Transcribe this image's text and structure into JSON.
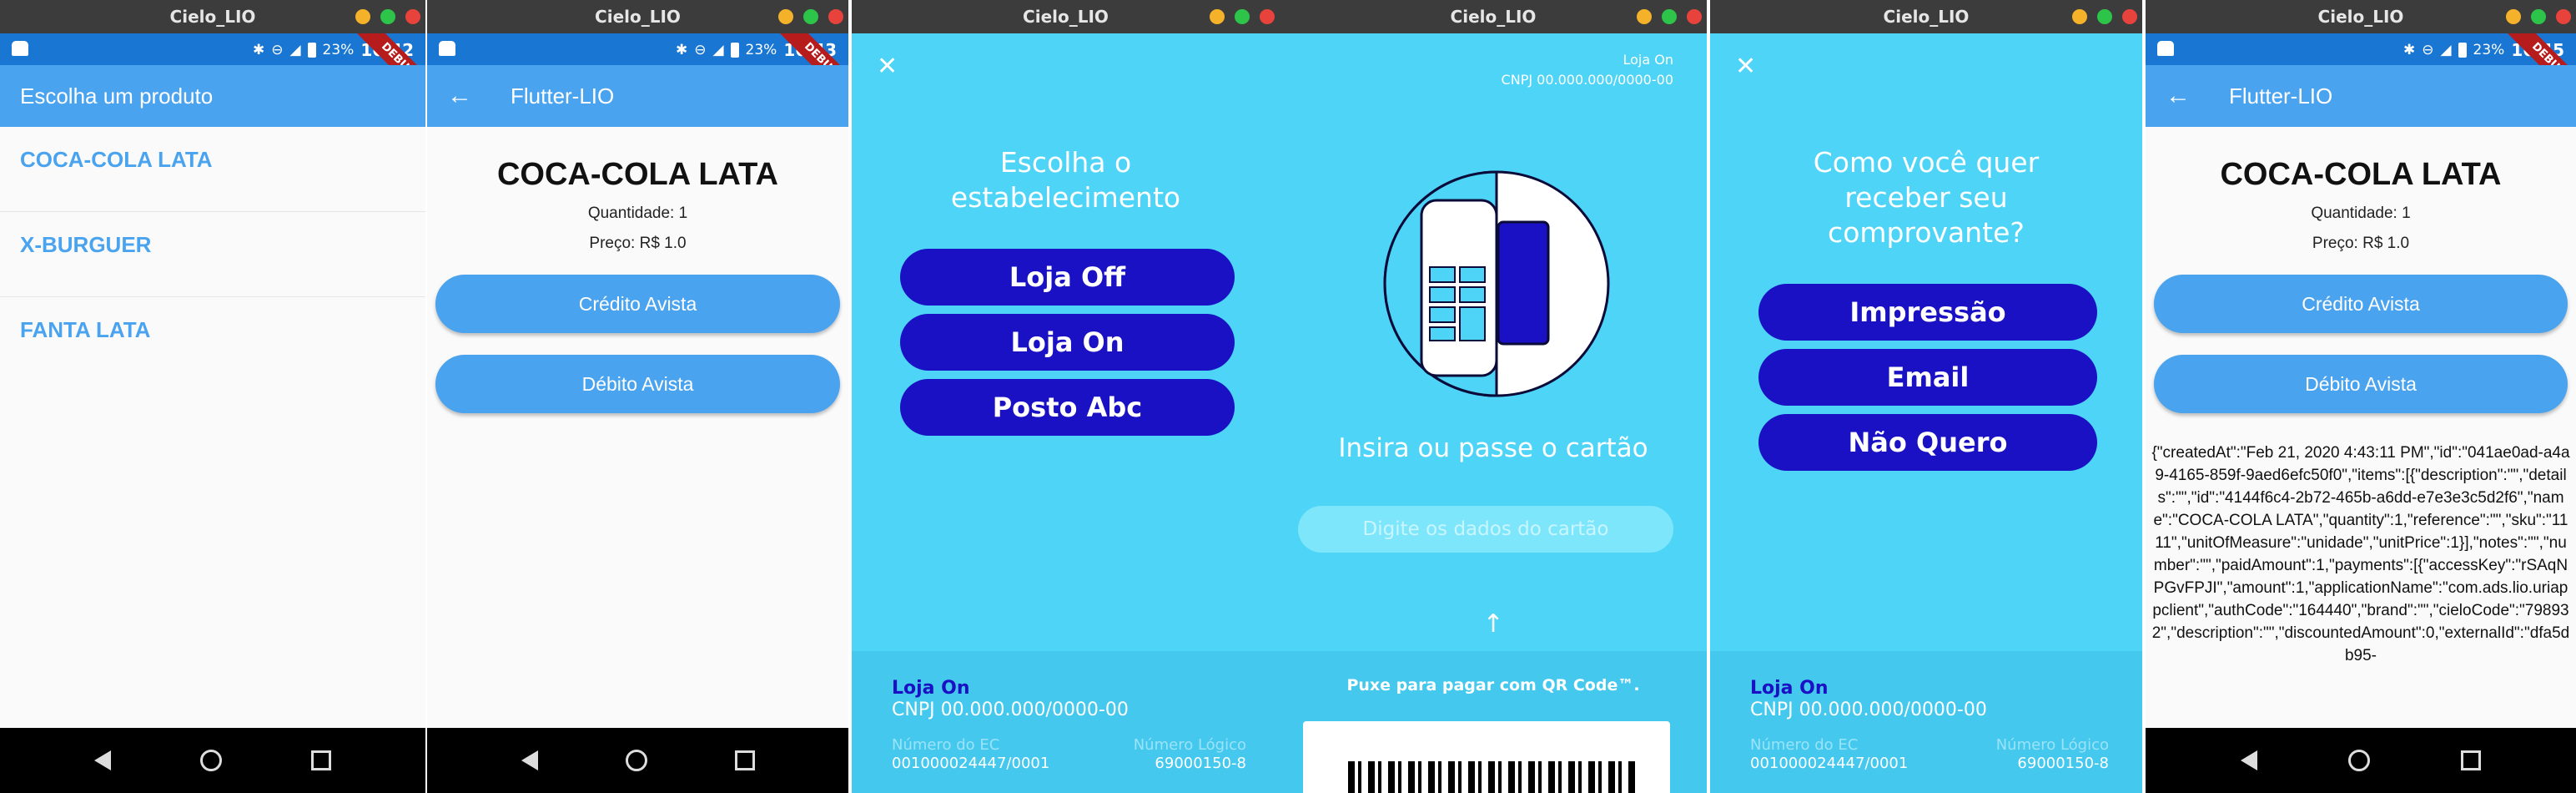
{
  "window_title": "Cielo_LIO",
  "status": {
    "battery": "23%",
    "times": [
      "16:42",
      "16:43",
      "16:45"
    ],
    "debug": "DEBUG"
  },
  "screen1": {
    "appbar_title": "Escolha um produto",
    "products": [
      "COCA-COLA LATA",
      "X-BURGUER",
      "FANTA LATA"
    ]
  },
  "screen2": {
    "appbar_title": "Flutter-LIO",
    "product_name": "COCA-COLA LATA",
    "quantity": "Quantidade: 1",
    "price": "Preço: R$ 1.0",
    "credit_label": "Crédito Avista",
    "debit_label": "Débito Avista"
  },
  "screen3": {
    "heading_line1": "Escolha o",
    "heading_line2": "estabelecimento",
    "options": [
      "Loja Off",
      "Loja On",
      "Posto Abc"
    ]
  },
  "screen4": {
    "store": "Loja On",
    "cnpj": "CNPJ 00.000.000/0000-00",
    "instruction": "Insira ou passe o cartão",
    "manual_entry": "Digite os dados do cartão",
    "qr_hint": "Puxe para pagar com QR Code™."
  },
  "screen5": {
    "heading_line1": "Como você quer",
    "heading_line2": "receber seu",
    "heading_line3": "comprovante?",
    "options": [
      "Impressão",
      "Email",
      "Não Quero"
    ]
  },
  "footer": {
    "store": "Loja On",
    "cnpj": "CNPJ  00.000.000/0000-00",
    "ec_label": "Número do EC",
    "ec_value": "001000024447/0001",
    "logic_label": "Número Lógico",
    "logic_value": "69000150-8"
  },
  "screen6": {
    "appbar_title": "Flutter-LIO",
    "product_name": "COCA-COLA LATA",
    "quantity": "Quantidade: 1",
    "price": "Preço: R$ 1.0",
    "credit_label": "Crédito Avista",
    "debit_label": "Débito Avista",
    "response_json": "{\"createdAt\":\"Feb 21, 2020 4:43:11 PM\",\"id\":\"041ae0ad-a4a9-4165-859f-9aed6efc50f0\",\"items\":[{\"description\":\"\",\"details\":\"\",\"id\":\"4144f6c4-2b72-465b-a6dd-e7e3e3c5d2f6\",\"name\":\"COCA-COLA LATA\",\"quantity\":1,\"reference\":\"\",\"sku\":\"1111\",\"unitOfMeasure\":\"unidade\",\"unitPrice\":1}],\"notes\":\"\",\"number\":\"\",\"paidAmount\":1,\"payments\":[{\"accessKey\":\"rSAqNPGvFPJI\",\"amount\":1,\"applicationName\":\"com.ads.lio.uriappclient\",\"authCode\":\"164440\",\"brand\":\"\",\"cieloCode\":\"798932\",\"description\":\"\",\"discountedAmount\":0,\"externalId\":\"dfa5db95-"
  }
}
